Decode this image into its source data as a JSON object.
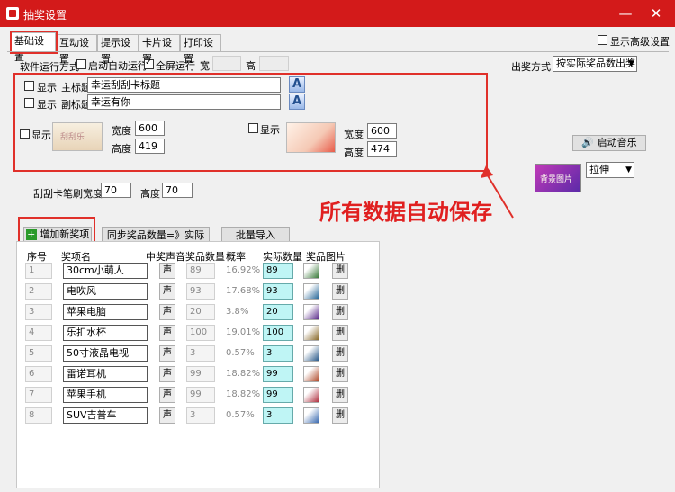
{
  "window": {
    "title": "抽奖设置",
    "minimize": "—",
    "close": "✕"
  },
  "tabs": [
    "基础设置",
    "互动设置",
    "提示设置",
    "卡片设置",
    "打印设置"
  ],
  "show_advanced": "显示高级设置",
  "run_mode": {
    "label": "软件运行方式",
    "auto_run": "启动自动运行",
    "fullscreen": "全屏运行",
    "width_label": "宽",
    "height_label": "高"
  },
  "draw_mode": {
    "label": "出奖方式",
    "value": "按实际奖品数出奖"
  },
  "title_section": {
    "show": "显示",
    "main_label": "主标题",
    "main_value": "幸运刮刮卡标题",
    "sub_label": "副标题",
    "sub_value": "幸运有你",
    "a_glyph": "A"
  },
  "image1": {
    "show": "显示",
    "width_label": "宽度",
    "width": "600",
    "height_label": "高度",
    "height": "419",
    "caption": "刮刮乐"
  },
  "image2": {
    "show": "显示",
    "width_label": "宽度",
    "width": "600",
    "height_label": "高度",
    "height": "474"
  },
  "music_button": "启动音乐",
  "bg_image": {
    "caption": "背景图片",
    "stretch": "拉伸"
  },
  "brush": {
    "width_label": "刮刮卡笔刷宽度",
    "width": "70",
    "height_label": "高度",
    "height": "70"
  },
  "overlay_note": "所有数据自动保存",
  "add_prize": "增加新奖项",
  "sync_button": "同步奖品数量=》实际数量",
  "batch_import": "批量导入",
  "columns": [
    "序号",
    "奖项名",
    "中奖声音",
    "奖品数量",
    "概率",
    "实际数量",
    "奖品图片"
  ],
  "sound_label": "声",
  "delete_label": "删",
  "prizes": [
    {
      "seq": "1",
      "name": "30cm小萌人",
      "qty": "89",
      "rate": "16.92%",
      "actual": "89"
    },
    {
      "seq": "2",
      "name": "电吹风",
      "qty": "93",
      "rate": "17.68%",
      "actual": "93"
    },
    {
      "seq": "3",
      "name": "苹果电脑",
      "qty": "20",
      "rate": "3.8%",
      "actual": "20"
    },
    {
      "seq": "4",
      "name": "乐扣水杯",
      "qty": "100",
      "rate": "19.01%",
      "actual": "100"
    },
    {
      "seq": "5",
      "name": "50寸液晶电视",
      "qty": "3",
      "rate": "0.57%",
      "actual": "3"
    },
    {
      "seq": "6",
      "name": "雷诺耳机",
      "qty": "99",
      "rate": "18.82%",
      "actual": "99"
    },
    {
      "seq": "7",
      "name": "苹果手机",
      "qty": "99",
      "rate": "18.82%",
      "actual": "99"
    },
    {
      "seq": "8",
      "name": "SUV吉普车",
      "qty": "3",
      "rate": "0.57%",
      "actual": "3"
    }
  ],
  "colors": {
    "titlebar": "#d31a1a",
    "highlight": "#e0302a",
    "actual_bg": "#bff5f5"
  }
}
